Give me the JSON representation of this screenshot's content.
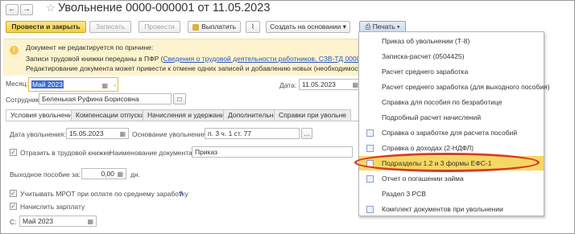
{
  "window": {
    "title": "Увольнение 0000-000001 от 11.05.2023"
  },
  "toolbar": {
    "post_close": "Провести и закрыть",
    "save": "Записать",
    "post": "Провести",
    "pay": "Выплатить",
    "create_based": "Создать на основании",
    "print": "Печать"
  },
  "notice": {
    "title": "Документ не редактируется по причине:",
    "line1_prefix": "Записи трудовой книжки переданы в ПФР (",
    "line1_link": "Сведения о трудовой деятельности работников, СЗВ-ТД 0000-00000",
    "line2": "Редактирование документа может привести к отмене одних записей и добавлению новых (необходимости нет"
  },
  "form": {
    "month_label": "Месяц:",
    "month_value": "Май 2023",
    "date_label": "Дата:",
    "date_value": "11.05.2023",
    "employee_label": "Сотрудник:",
    "employee_value": "Беленькая Руфина Борисовна"
  },
  "tabs": [
    "Условия увольнения",
    "Компенсации отпуска",
    "Начисления и удержания",
    "Дополнительно",
    "Справки при увольне"
  ],
  "conditions": {
    "dismissal_date_label": "Дата увольнения:",
    "dismissal_date_value": "15.05.2023",
    "basis_label": "Основание увольнения:",
    "basis_value": "п. 3 ч. 1 ст. 77",
    "reflect_label": "Отразить в трудовой книжке",
    "doc_name_label": "Наименование документа:",
    "doc_name_value": "Приказ",
    "severance_label": "Выходное пособие за:",
    "severance_value": "0,00",
    "severance_unit": "дн.",
    "mrot_label": "Учитывать МРОТ при оплате по среднему заработку",
    "help_mark": "?",
    "accrue_label": "Начислить зарплату",
    "from_label": "С:",
    "from_value": "Май 2023"
  },
  "print_menu": [
    {
      "label": "Приказ об увольнении (Т-8)",
      "icon": "none"
    },
    {
      "label": "Записка-расчет (0504425)",
      "icon": "none"
    },
    {
      "label": "Расчет среднего заработка",
      "icon": "none"
    },
    {
      "label": "Расчет среднего заработка (для выходного пособия)",
      "icon": "none"
    },
    {
      "label": "Справка для пособия по безработице",
      "icon": "none"
    },
    {
      "label": "Подробный расчет начислений",
      "icon": "none"
    },
    {
      "label": "Справка о заработке для расчета пособий",
      "icon": "document-icon"
    },
    {
      "label": "Справка о доходах (2-НДФЛ)",
      "icon": "document-icon"
    },
    {
      "label": "Подразделы 1.2 и 3 формы ЕФС-1",
      "icon": "document-icon"
    },
    {
      "label": "Отчет о погашении займа",
      "icon": "document-icon"
    },
    {
      "label": "Раздел 3 РСВ",
      "icon": "none"
    },
    {
      "label": "Комплект документов при увольнении",
      "icon": "document-icon"
    }
  ],
  "colors": {
    "highlight": "#f7d763",
    "annotation": "#d63a24",
    "primary_button": "#f4cf3c",
    "link": "#2a55c2"
  }
}
